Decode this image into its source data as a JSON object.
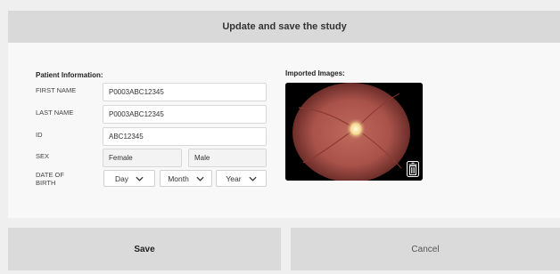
{
  "header": {
    "title": "Update and save the study"
  },
  "patient": {
    "section_title": "Patient Information:",
    "first_name_label": "FIRST NAME",
    "first_name_value": "P0003ABC12345",
    "last_name_label": "LAST NAME",
    "last_name_value": "P0003ABC12345",
    "id_label": "ID",
    "id_value": "ABC12345",
    "sex_label": "SEX",
    "sex_options": [
      "Female",
      "Male"
    ],
    "dob_label_line1": "DATE OF",
    "dob_label_line2": "BIRTH",
    "dob_day": "Day",
    "dob_month": "Month",
    "dob_year": "Year"
  },
  "images": {
    "section_title": "Imported Images:",
    "delete_icon": "trash-icon"
  },
  "footer": {
    "save_label": "Save",
    "cancel_label": "Cancel"
  },
  "colors": {
    "header_bg": "#d9d9d9",
    "panel_bg": "#f8f8f8",
    "button_bg": "#dadada",
    "fundus_base": "#b5605a",
    "optic_disc": "#fff0c0"
  }
}
